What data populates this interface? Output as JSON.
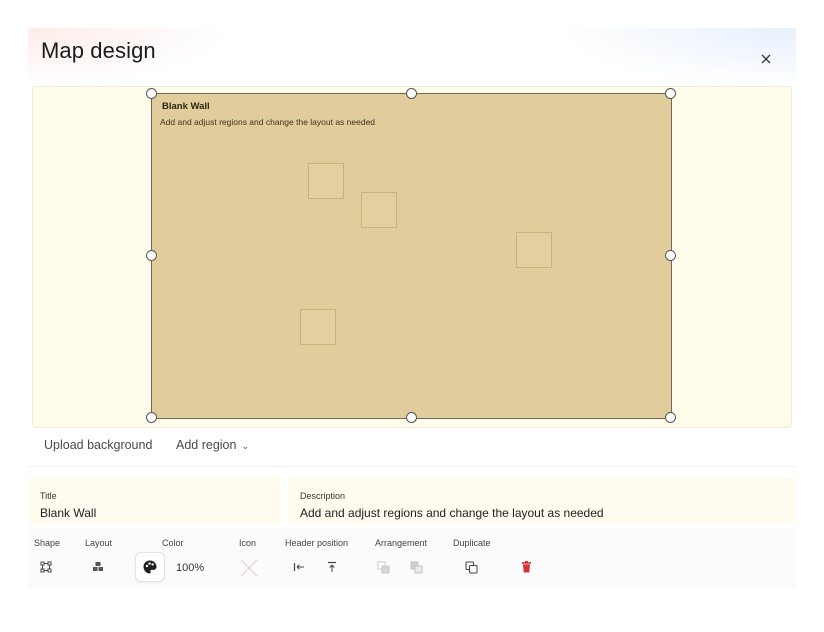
{
  "dialog": {
    "title": "Map design",
    "close_icon": "close-icon"
  },
  "region": {
    "title": "Blank Wall",
    "description": "Add and adjust regions and change the layout as needed",
    "fill_color": "#e1cd9b"
  },
  "toolbar": {
    "upload_background": "Upload background",
    "add_region": "Add region"
  },
  "fields": {
    "title_label": "Title",
    "title_value": "Blank Wall",
    "description_label": "Description",
    "description_value": "Add and adjust regions and change the layout as needed"
  },
  "properties": {
    "shape_label": "Shape",
    "layout_label": "Layout",
    "color_label": "Color",
    "color_opacity": "100%",
    "icon_label": "Icon",
    "header_position_label": "Header position",
    "arrangement_label": "Arrangement",
    "duplicate_label": "Duplicate"
  },
  "colors": {
    "canvas_bg": "#fffcec",
    "region_fill": "#e1cd9b",
    "delete_red": "#d13438"
  },
  "icons": [
    "close-icon",
    "chevron-down-icon",
    "shape-icon",
    "layout-icon",
    "palette-icon",
    "no-icon-icon",
    "align-left-header-icon",
    "align-top-header-icon",
    "send-backward-icon",
    "bring-forward-icon",
    "duplicate-icon",
    "delete-icon"
  ]
}
